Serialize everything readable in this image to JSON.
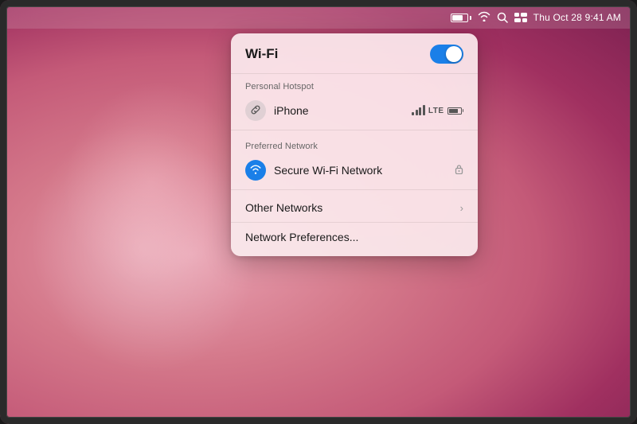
{
  "menubar": {
    "time": "Thu Oct 28  9:41 AM"
  },
  "panel": {
    "title": "Wi-Fi",
    "toggle_on": true,
    "personal_hotspot_label": "Personal Hotspot",
    "iphone_name": "iPhone",
    "preferred_network_label": "Preferred Network",
    "secure_network_name": "Secure Wi-Fi Network",
    "other_networks_label": "Other Networks",
    "prefs_label": "Network Preferences..."
  }
}
